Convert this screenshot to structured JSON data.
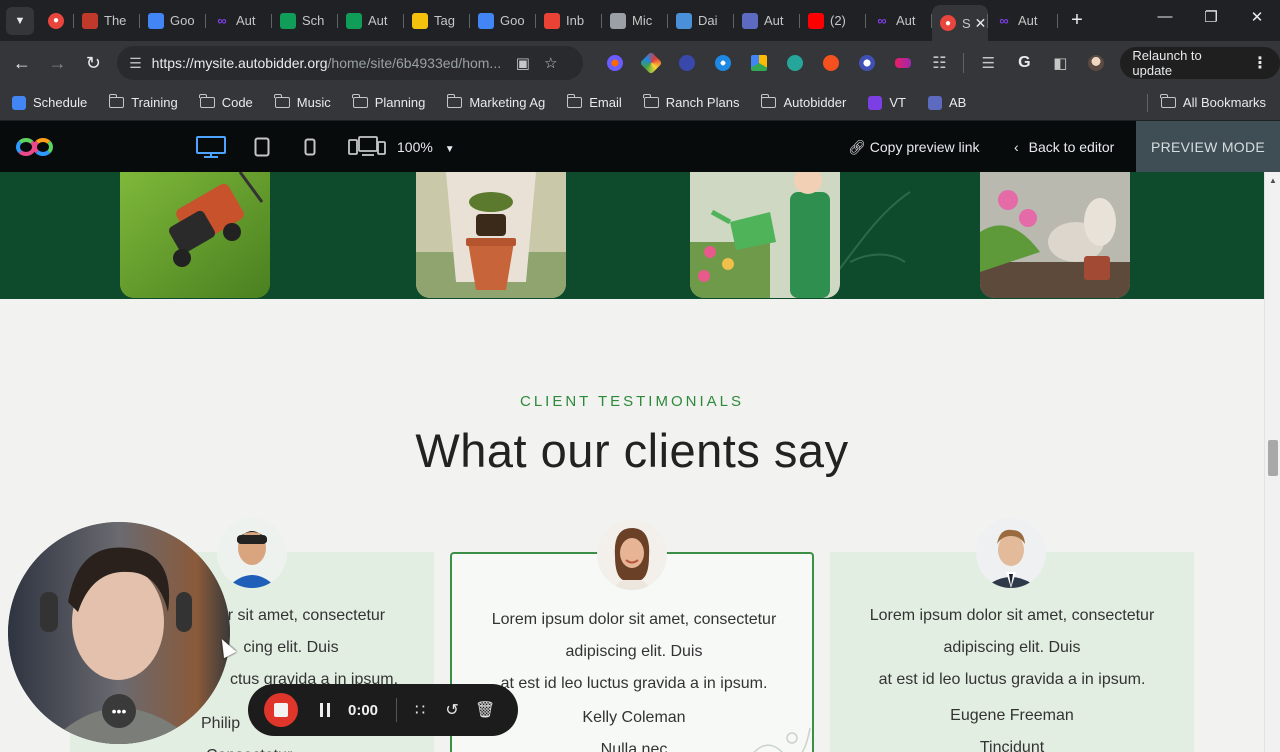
{
  "browser": {
    "tabs": [
      {
        "label": "",
        "icon": "record-icon",
        "color": "#e8453c"
      },
      {
        "label": "The",
        "icon": "site-icon",
        "color": "#c0392b"
      },
      {
        "label": "Goo",
        "icon": "calendar-icon",
        "color": "#4285f4"
      },
      {
        "label": "Aut",
        "icon": "autobidder-icon",
        "color": "#7b3fe4"
      },
      {
        "label": "Sch",
        "icon": "sheets-icon",
        "color": "#0f9d58"
      },
      {
        "label": "Aut",
        "icon": "plus-sheet-icon",
        "color": "#0f9d58"
      },
      {
        "label": "Tag",
        "icon": "tag-icon",
        "color": "#f4c20d"
      },
      {
        "label": "Goo",
        "icon": "docs-icon",
        "color": "#4285f4"
      },
      {
        "label": "Inb",
        "icon": "gmail-icon",
        "color": "#ea4335"
      },
      {
        "label": "Mic",
        "icon": "msft-icon",
        "color": "#9aa0a6"
      },
      {
        "label": "Dai",
        "icon": "doc-icon",
        "color": "#4a90d9"
      },
      {
        "label": "Aut",
        "icon": "chat-icon",
        "color": "#5c6bc0"
      },
      {
        "label": "(2)",
        "icon": "youtube-icon",
        "color": "#ff0000"
      },
      {
        "label": "Aut",
        "icon": "autobidder-icon",
        "color": "#7b3fe4"
      }
    ],
    "active_tab": {
      "label": "S",
      "icon": "record-icon",
      "color": "#e8453c"
    },
    "last_tab": {
      "label": "Aut",
      "icon": "autobidder-icon",
      "color": "#7b3fe4"
    },
    "url_host": "https://mysite.autobidder.org",
    "url_path": "/home/site/6b4933ed/hom...",
    "relaunch_label": "Relaunch to update",
    "bookmarks": [
      {
        "label": "Schedule",
        "type": "app"
      },
      {
        "label": "Training",
        "type": "folder"
      },
      {
        "label": "Code",
        "type": "folder"
      },
      {
        "label": "Music",
        "type": "folder"
      },
      {
        "label": "Planning",
        "type": "folder"
      },
      {
        "label": "Marketing Ag",
        "type": "folder"
      },
      {
        "label": "Email",
        "type": "folder"
      },
      {
        "label": "Ranch Plans",
        "type": "folder"
      },
      {
        "label": "Autobidder",
        "type": "folder"
      },
      {
        "label": "VT",
        "type": "app"
      },
      {
        "label": "AB",
        "type": "app"
      }
    ],
    "all_bookmarks": "All Bookmarks"
  },
  "editor": {
    "zoom": "100%",
    "copy_link": "Copy preview link",
    "back": "Back to editor",
    "mode": "PREVIEW MODE"
  },
  "page": {
    "eyebrow": "CLIENT TESTIMONIALS",
    "heading": "What our clients say",
    "testimonials": [
      {
        "quote1": "or sit amet, consectetur",
        "quote2": "cing elit. Duis",
        "quote3": "ctus gravida a in ipsum.",
        "name": "Philip",
        "role": "Consectetur"
      },
      {
        "quote1": "Lorem ipsum dolor sit amet, consectetur",
        "quote2": "adipiscing elit. Duis",
        "quote3": "at est id leo luctus gravida a in ipsum.",
        "name": "Kelly Coleman",
        "role": "Nulla nec"
      },
      {
        "quote1": "Lorem ipsum dolor sit amet, consectetur",
        "quote2": "adipiscing elit. Duis",
        "quote3": "at est id leo luctus gravida a in ipsum.",
        "name": "Eugene Freeman",
        "role": "Tincidunt"
      }
    ]
  },
  "recorder": {
    "timer": "0:00"
  },
  "colors": {
    "accent_green": "#2d8a3a",
    "band_green": "#0e4a2c",
    "record_red": "#e0352b"
  }
}
